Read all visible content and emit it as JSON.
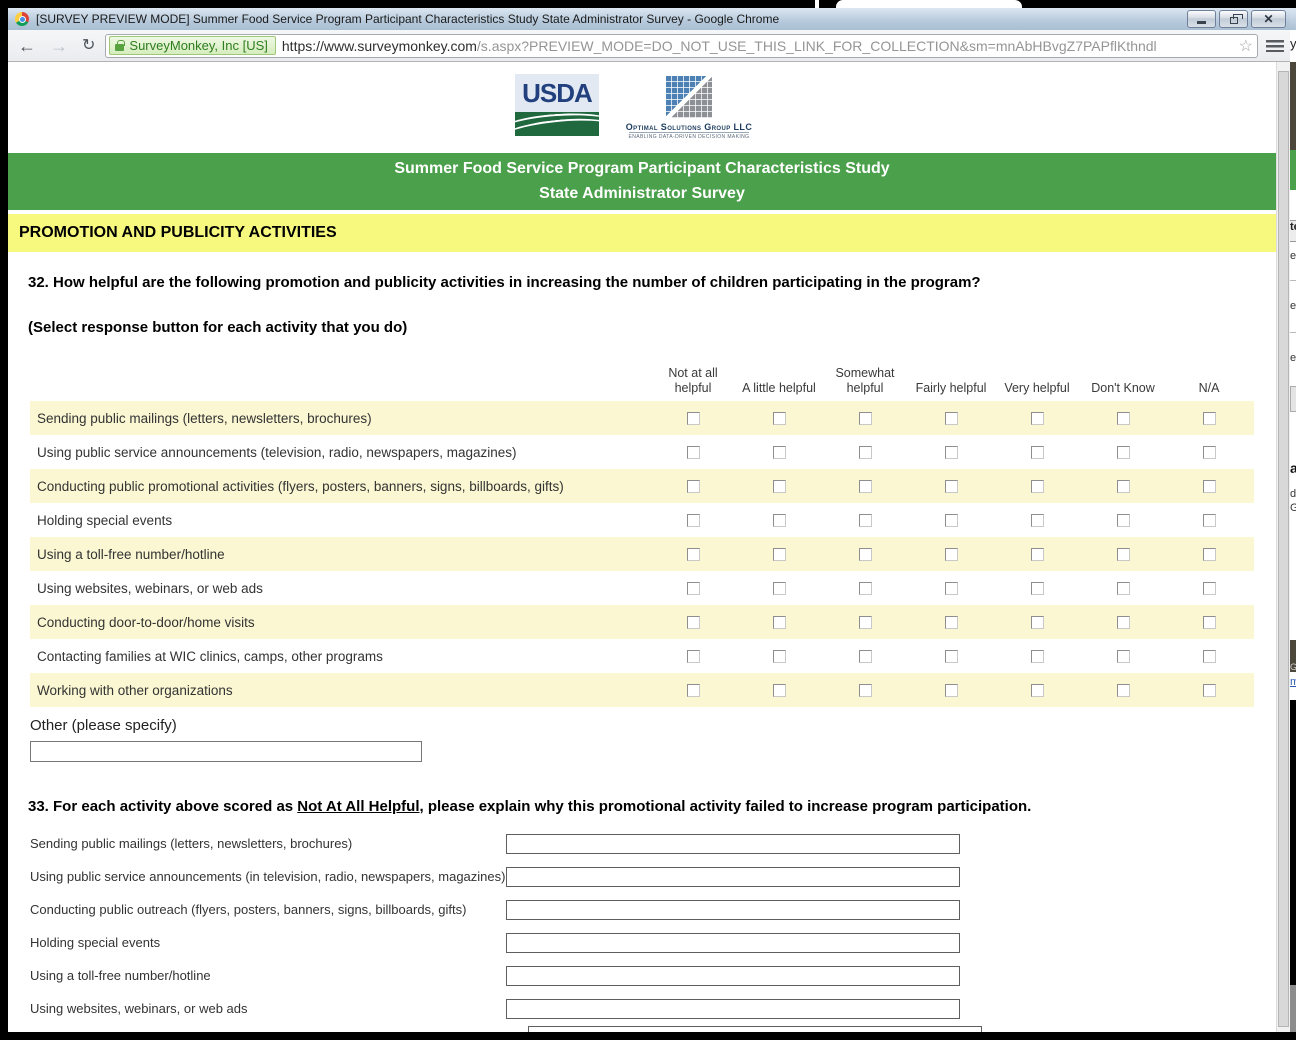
{
  "window": {
    "title": "[SURVEY PREVIEW MODE] Summer Food Service Program Participant Characteristics Study State Administrator Survey - Google Chrome"
  },
  "toolbar": {
    "ev_badge": "SurveyMonkey, Inc [US]",
    "url_domain": "https://www.surveymonkey.com",
    "url_path": "/s.aspx?PREVIEW_MODE=DO_NOT_USE_THIS_LINK_FOR_COLLECTION&sm=mnAbHBvgZ7PAPflKthndl"
  },
  "logos": {
    "usda": "USDA",
    "osg_name": "Optimal Solutions Group LLC",
    "osg_tagline": "ENABLING DATA-DRIVEN DECISION MAKING"
  },
  "banner": {
    "line1": "Summer Food Service Program Participant Characteristics Study",
    "line2": "State Administrator Survey"
  },
  "section": {
    "title": "PROMOTION AND PUBLICITY ACTIVITIES"
  },
  "q32": {
    "question": "32. How helpful are the following promotion and publicity activities in increasing the number of children participating in the program?",
    "instruction": "(Select response button for each activity that you do)",
    "columns": [
      "Not at all helpful",
      "A little helpful",
      "Somewhat helpful",
      "Fairly helpful",
      "Very helpful",
      "Don't Know",
      "N/A"
    ],
    "rows": [
      "Sending public mailings (letters, newsletters, brochures)",
      "Using public service announcements (television, radio, newspapers, magazines)",
      "Conducting public promotional activities (flyers, posters, banners, signs, billboards, gifts)",
      "Holding special events",
      "Using a toll-free number/hotline",
      "Using websites, webinars, or web ads",
      "Conducting door-to-door/home visits",
      "Contacting families at WIC clinics, camps, other programs",
      "Working with other organizations"
    ],
    "checked": [],
    "other_label": "Other (please specify)",
    "other_value": ""
  },
  "q33": {
    "prefix": "33. For each activity above scored as ",
    "underlined": "Not At All Helpful",
    "suffix": ", please explain why this promotional activity failed to increase program participation.",
    "rows": [
      "Sending public mailings (letters, newsletters, brochures)",
      "Using public service announcements (in television, radio, newspapers, magazines)",
      "Conducting public outreach (flyers, posters, banners, signs, billboards, gifts)",
      "Holding special events",
      "Using a toll-free number/hotline",
      "Using websites, webinars, or web ads"
    ],
    "values": [
      "",
      "",
      "",
      "",
      "",
      ""
    ]
  },
  "colors": {
    "banner_green": "#4ba04b",
    "section_yellow": "#f7f97f",
    "row_yellow": "#faf7d2",
    "ev_green": "#2e7d1f"
  },
  "behind_window": {
    "fragments": [
      "y",
      "te",
      "er",
      "er",
      "er",
      "a",
      "d",
      "G",
      "G",
      "m"
    ]
  }
}
